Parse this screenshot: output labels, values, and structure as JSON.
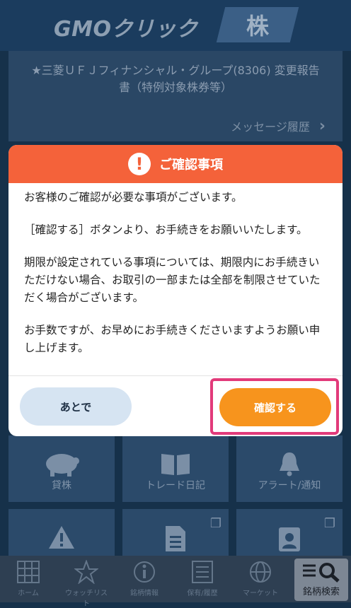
{
  "header": {
    "logo": "GMOクリック",
    "logo_badge": "株"
  },
  "notice": {
    "title": "★三菱ＵＦＪフィナンシャル・グループ(8306) 変更報告書（特例対象株券等）",
    "history_link": "メッセージ履歴"
  },
  "modal": {
    "title": "ご確認事項",
    "paragraphs": [
      "お客様のご確認が必要な事項がございます。",
      "［確認する］ボタンより、お手続きをお願いいたします。",
      "期限が設定されている事項については、期限内にお手続きいただけない場合、お取引の一部または全部を制限させていただく場合がございます。",
      "お手数ですが、お早めにお手続きくださいますようお願い申し上げます。"
    ],
    "later_button": "あとで",
    "confirm_button": "確認する"
  },
  "tiles": [
    "貸株",
    "トレード日記",
    "アラート/通知"
  ],
  "bottom_nav": [
    "ホーム",
    "ウォッチリスト",
    "銘柄情報",
    "保有/履歴",
    "マーケット",
    "銘柄検索"
  ],
  "colors": {
    "header_bg": "#1b3c5e",
    "modal_header": "#f4623a",
    "confirm": "#f7941d",
    "highlight": "#e23a7a"
  }
}
